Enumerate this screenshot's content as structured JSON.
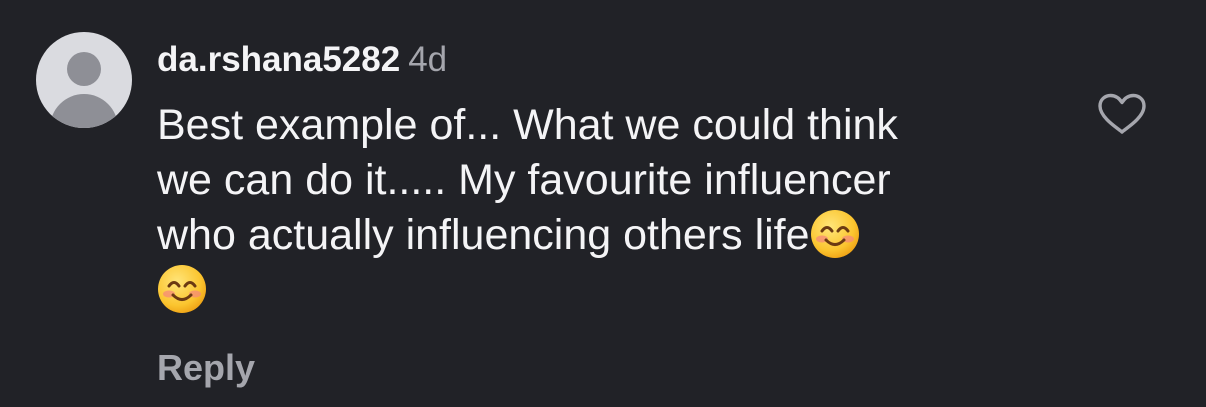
{
  "comment": {
    "username": "da.rshana5282",
    "time": "4d",
    "text_lines": [
      "Best example of... What we could think",
      "we can do it..... My favourite influencer",
      "who actually influencing others life"
    ],
    "emojis": [
      "smiling-face-emoji",
      "smiling-face-emoji"
    ],
    "reply_label": "Reply",
    "like_icon": "heart-outline-icon",
    "avatar_icon": "default-avatar-icon"
  },
  "colors": {
    "background": "#212227",
    "primary_text": "#f4f4f6",
    "secondary_text": "#a5a6ad",
    "avatar_bg": "#dadbe0",
    "avatar_fg": "#8e8f96"
  }
}
